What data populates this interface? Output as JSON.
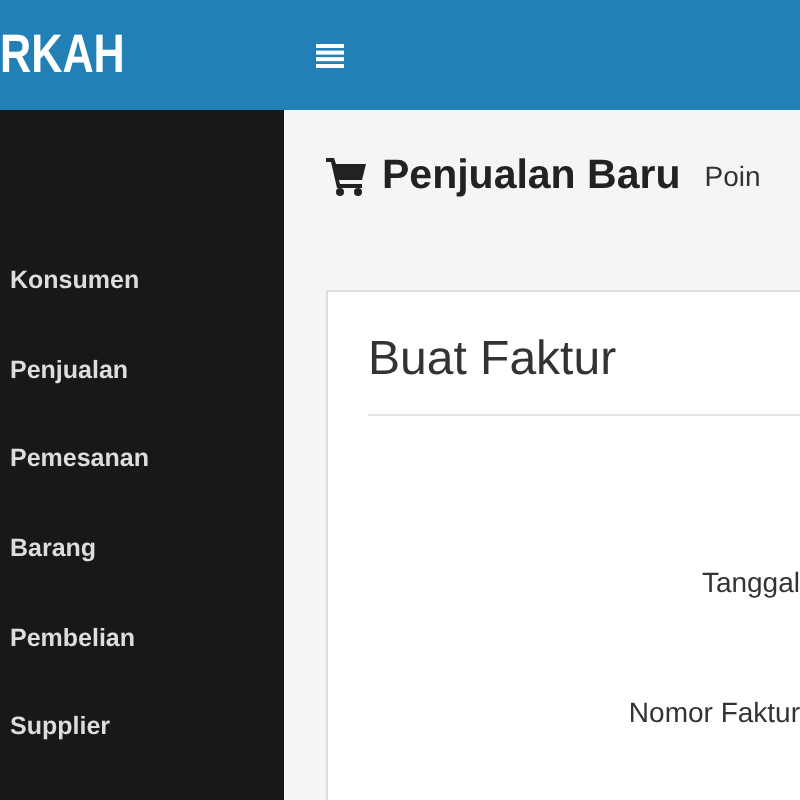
{
  "brand": "RKAH",
  "sidebar": {
    "items": [
      {
        "label": "Konsumen"
      },
      {
        "label": "Penjualan"
      },
      {
        "label": "Pemesanan"
      },
      {
        "label": "Barang"
      },
      {
        "label": "Pembelian"
      },
      {
        "label": "Supplier"
      }
    ]
  },
  "page_header": {
    "title": "Penjualan Baru",
    "subtitle": "Poin"
  },
  "card": {
    "title": "Buat Faktur",
    "fields": [
      {
        "label": "Tanggal"
      },
      {
        "label": "Nomor Faktur"
      }
    ]
  }
}
